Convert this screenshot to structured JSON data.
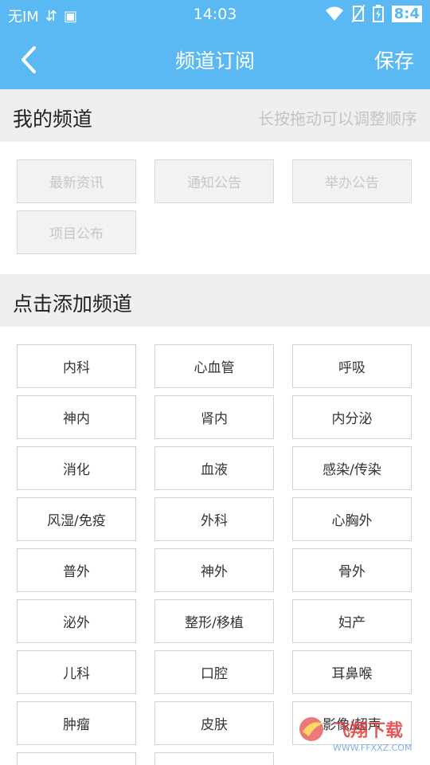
{
  "status_bar": {
    "time": "14:03",
    "carrier": "无IM",
    "battery": "8:4"
  },
  "navbar": {
    "title": "频道订阅",
    "save_label": "保存"
  },
  "my_channels": {
    "title": "我的频道",
    "hint": "长按拖动可以调整顺序",
    "items": [
      "最新资讯",
      "通知公告",
      "举办公告",
      "项目公布"
    ]
  },
  "add_channels": {
    "title": "点击添加频道",
    "items": [
      "内科",
      "心血管",
      "呼吸",
      "神内",
      "肾内",
      "内分泌",
      "消化",
      "血液",
      "感染/传染",
      "风湿/免疫",
      "外科",
      "心胸外",
      "普外",
      "神外",
      "骨外",
      "泌外",
      "整形/移植",
      "妇产",
      "儿科",
      "口腔",
      "耳鼻喉",
      "肿瘤",
      "皮肤",
      "影像/超声"
    ]
  },
  "watermark": {
    "text": "飞翔下载",
    "url": "WWW.FFXXZ.COM"
  },
  "colors": {
    "primary": "#5AB9F3",
    "section_bg": "#efefef",
    "tile_border": "#d3d3d3"
  }
}
